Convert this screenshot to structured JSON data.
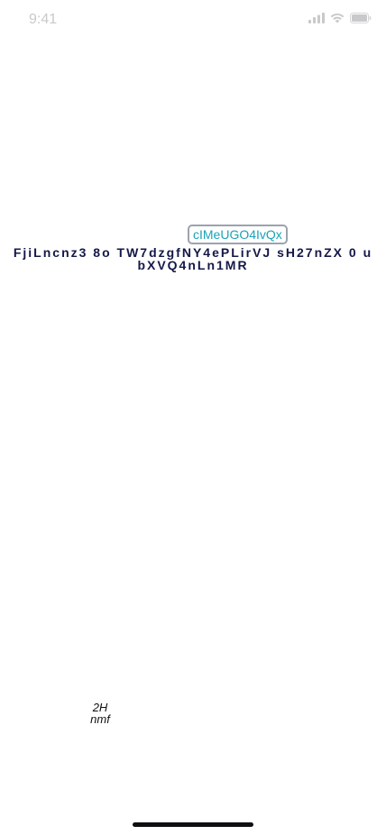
{
  "status_bar": {
    "time": "9:41",
    "icons": [
      "signal-icon",
      "wifi-icon",
      "battery-icon"
    ]
  },
  "main": {
    "badge_label": "cIMeUGO4IvQx",
    "headline_line1": "FjiLncnz3 8o TW7dzgfNY4ePLirVJ sH27nZX  0 u",
    "headline_line2": "bXVQ4nLn1MR"
  },
  "footer": {
    "label_top": "2H",
    "label_bottom": "nmf"
  },
  "colors": {
    "badge_text": "#18a3b8",
    "badge_border": "#9ba3ad",
    "headline_text": "#141848",
    "status_gray": "#c9c9cc",
    "home_indicator": "#0f0f12"
  }
}
